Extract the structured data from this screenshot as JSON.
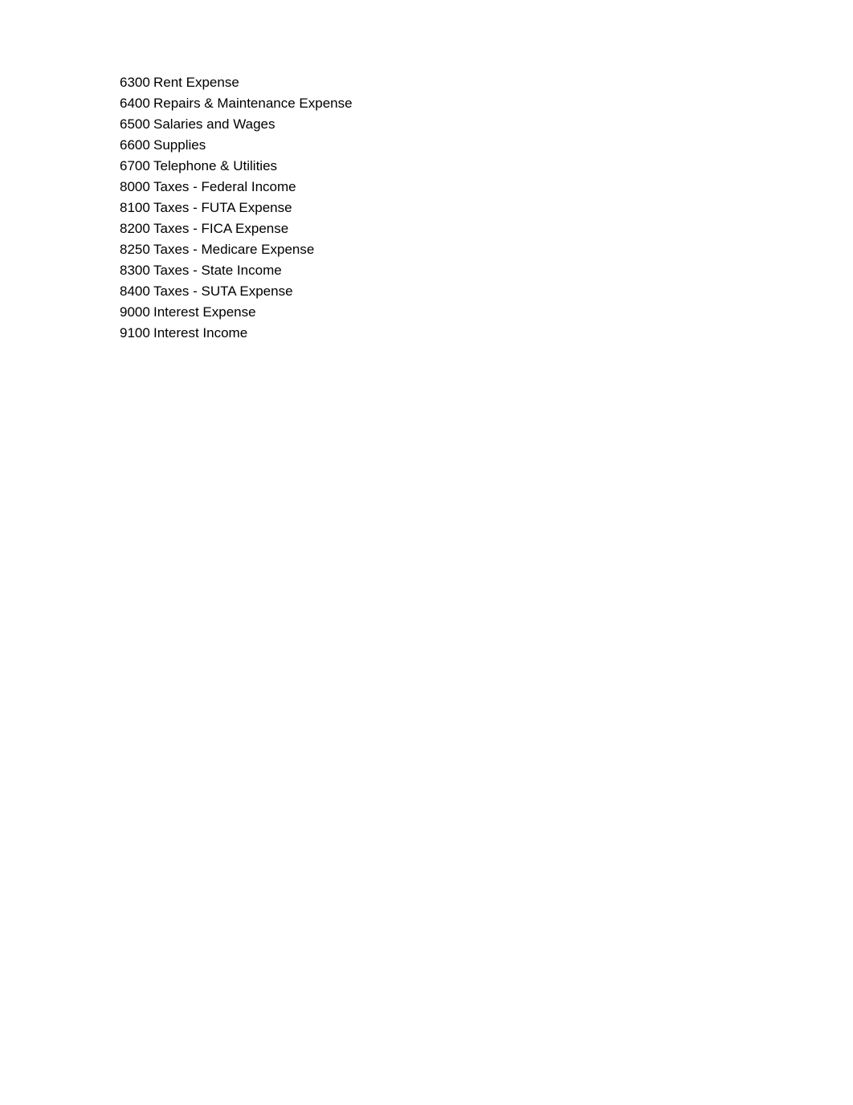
{
  "accounts": [
    {
      "number": "6300",
      "name": "Rent Expense"
    },
    {
      "number": "6400",
      "name": "Repairs & Maintenance Expense"
    },
    {
      "number": "6500",
      "name": "Salaries and Wages"
    },
    {
      "number": "6600",
      "name": "Supplies"
    },
    {
      "number": "6700",
      "name": "Telephone & Utilities"
    },
    {
      "number": "8000",
      "name": "Taxes - Federal Income"
    },
    {
      "number": "8100",
      "name": "Taxes - FUTA Expense"
    },
    {
      "number": "8200",
      "name": "Taxes - FICA Expense"
    },
    {
      "number": "8250",
      "name": "Taxes - Medicare Expense"
    },
    {
      "number": "8300",
      "name": "Taxes - State Income"
    },
    {
      "number": "8400",
      "name": "Taxes - SUTA Expense"
    },
    {
      "number": "9000",
      "name": "Interest Expense"
    },
    {
      "number": "9100",
      "name": "Interest Income"
    }
  ]
}
